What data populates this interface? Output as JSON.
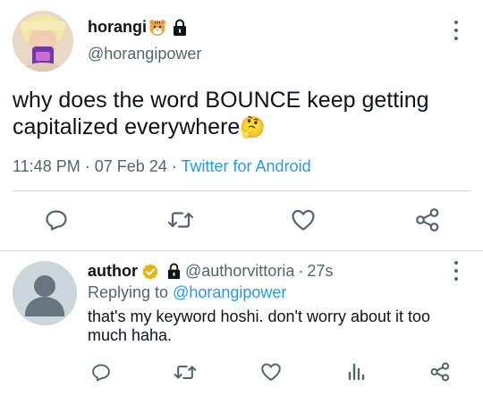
{
  "tweet": {
    "display_name": "horangi",
    "handle": "@horangipower",
    "text_part": "why does the word BOUNCE keep getting capitalized everywhere",
    "emoji": "🤔",
    "time": "11:48 PM",
    "date": "07 Feb 24",
    "separator": "·",
    "source": "Twitter for Android",
    "icons": [
      "tiger-emoji",
      "lock-icon",
      "more-icon",
      "reply-icon",
      "retweet-icon",
      "like-icon",
      "share-icon"
    ]
  },
  "reply": {
    "display_name": "author",
    "handle": "@authorvittoria",
    "time_sep": "·",
    "time": "27s",
    "replying_prefix": "Replying to",
    "replying_to": "@horangipower",
    "text": "that's my keyword hoshi. don't worry about it too much haha.",
    "icons": [
      "verified-badge-icon",
      "lock-icon",
      "more-icon",
      "reply-icon",
      "retweet-icon",
      "like-icon",
      "analytics-icon",
      "share-icon"
    ]
  },
  "colors": {
    "accent": "#1d9bf0",
    "secondary_text": "#536471",
    "verified_gold": "#e2b719"
  }
}
